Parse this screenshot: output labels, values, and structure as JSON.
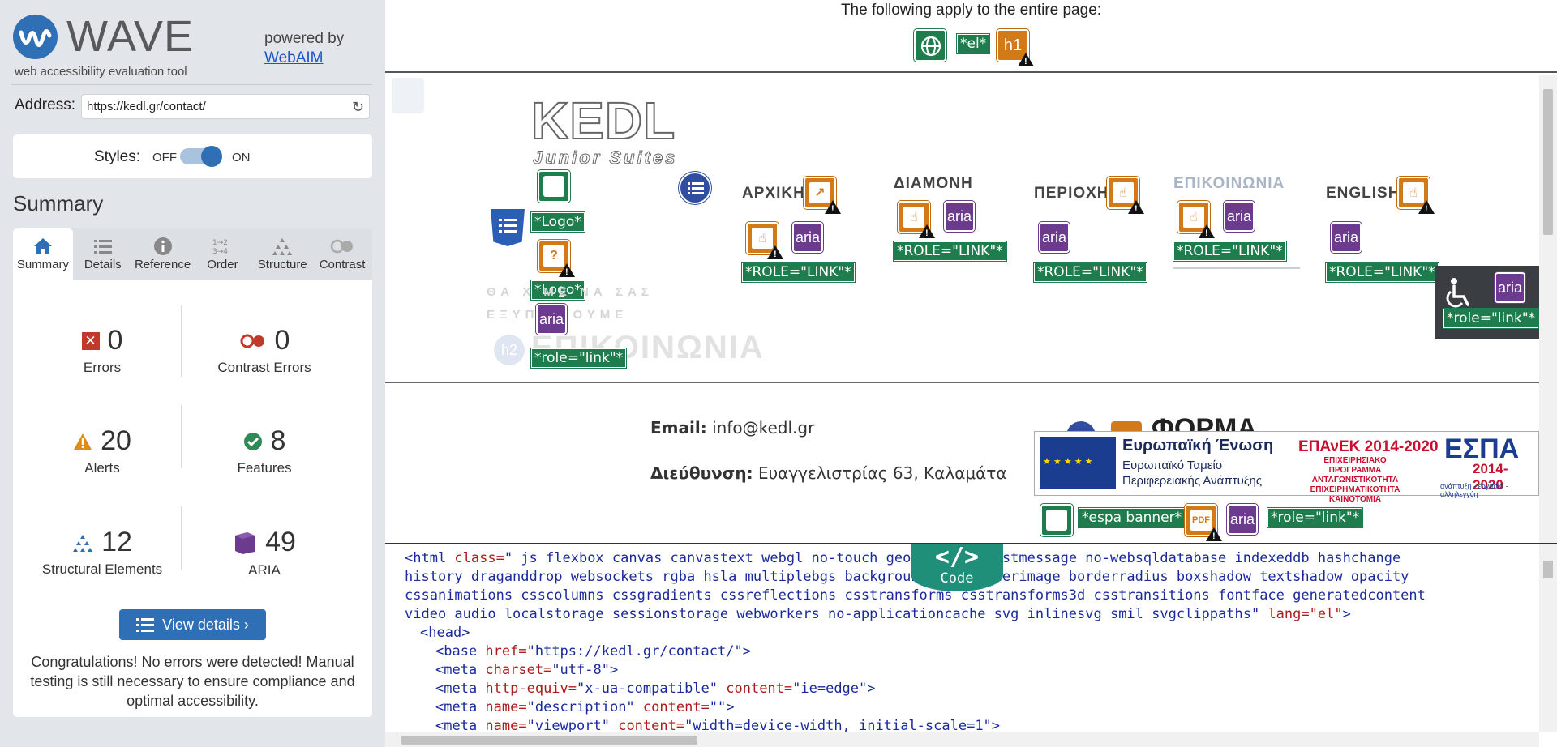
{
  "sidebar": {
    "brand": "WAVE",
    "tagline": "web accessibility evaluation tool",
    "powered_by": "powered by",
    "powered_link": "WebAIM",
    "address_label": "Address:",
    "address_value": "https://kedl.gr/contact/",
    "styles_label": "Styles:",
    "styles_off": "OFF",
    "styles_on": "ON",
    "styles_state": "on",
    "summary_title": "Summary",
    "tabs": [
      {
        "label": "Summary",
        "icon": "home-icon",
        "active": true
      },
      {
        "label": "Details",
        "icon": "list-icon",
        "active": false
      },
      {
        "label": "Reference",
        "icon": "info-icon",
        "active": false
      },
      {
        "label": "Order",
        "icon": "order-icon",
        "active": false
      },
      {
        "label": "Structure",
        "icon": "structure-icon",
        "active": false
      },
      {
        "label": "Contrast",
        "icon": "contrast-icon",
        "active": false
      }
    ],
    "stats": {
      "errors": {
        "value": "0",
        "label": "Errors"
      },
      "contrast": {
        "value": "0",
        "label": "Contrast Errors"
      },
      "alerts": {
        "value": "20",
        "label": "Alerts"
      },
      "features": {
        "value": "8",
        "label": "Features"
      },
      "structural": {
        "value": "12",
        "label": "Structural Elements"
      },
      "aria": {
        "value": "49",
        "label": "ARIA"
      }
    },
    "view_details": "View details ›",
    "congrats": "Congratulations! No errors were detected! Manual testing is still necessary to ensure compliance and optimal accessibility."
  },
  "topbar": {
    "apply_text": "The following apply to the entire page:",
    "lang_tag": "*el*",
    "h1_label": "h1"
  },
  "preview": {
    "brand_title": "KEDL",
    "brand_subtitle": "Junior Suites",
    "logo_tag_1": "*Logo*",
    "logo_tag_2": "*Logo*",
    "role_link_lower": "*role=\"link\"*",
    "faded_line_1": "ΘΑ Χ   ΜΕ ΝΑ ΣΑΣ",
    "faded_line_2": "ΕΞΥΠ   ΗΣΟΥΜΕ",
    "faded_heading": "ΕΠΙΚΟΙΝΩΝΙΑ",
    "h2_label": "h2",
    "aria_label": "aria",
    "nav": [
      {
        "label": "ΑΡΧΙΚΗ",
        "tag": "*ROLE=\"LINK\"*"
      },
      {
        "label": "ΔΙΑΜΟΝΗ",
        "tag": "*ROLE=\"LINK\"*"
      },
      {
        "label": "ΠΕΡΙΟΧΗ",
        "tag": "*ROLE=\"LINK\"*"
      },
      {
        "label": "ΕΠΙΚΟΙΝΩΝΙΑ",
        "tag": "*ROLE=\"LINK\"*"
      },
      {
        "label": "ENGLISH",
        "tag": "*ROLE=\"LINK\"*"
      }
    ],
    "access_tag": "*role=\"link\"*",
    "email_label": "Email:",
    "email_value": "info@kedl.gr",
    "address_label": "Διεύθυνση:",
    "address_value": "Ευαγγελιστρίας 63, Καλαμάτα",
    "form_heading": "ΦΟΡΜΑ",
    "espa": {
      "title": "Ευρωπαϊκή Ένωση",
      "sub1": "Ευρωπαϊκό Ταμείο",
      "sub2": "Περιφερειακής Ανάπτυξης",
      "program": "ΕΠΑνΕΚ 2014-2020",
      "program_sub1": "ΕΠΙΧΕΙΡΗΣΙΑΚΟ ΠΡΟΓΡΑΜΜΑ",
      "program_sub2": "ΑΝΤΑΓΩΝΙΣΤΙΚΟΤΗΤΑ",
      "program_sub3": "ΕΠΙΧΕΙΡΗΜΑΤΙΚΟΤΗΤΑ",
      "program_sub4": "ΚΑΙΝΟΤΟΜΙΑ",
      "espa_title": "ΕΣΠΑ",
      "espa_years": "2014-2020",
      "espa_motto": "ανάπτυξη - εργασία - αλληλεγγύη"
    },
    "espa_tag": "*espa banner*",
    "pdf_label": "PDF",
    "espa_role_tag": "*role=\"link\"*"
  },
  "code": {
    "tab_label": "Code",
    "tab_symbol": "</>",
    "line1_tag": "<html",
    "line1_attr": " class=",
    "line1_val": "\" js flexbox canvas canvastext webgl no-touch geolocation postmessage no-websqldatabase indexeddb hashchange",
    "line2": "history draganddrop websockets rgba hsla multiplebgs backgroundsize borderimage borderradius boxshadow textshadow opacity",
    "line3": "cssanimations csscolumns cssgradients cssreflections csstransforms csstransforms3d csstransitions fontface generatedcontent",
    "line4_val": "video audio localstorage sessionstorage webworkers no-applicationcache svg inlinesvg smil svgclippaths\"",
    "line4_attr": " lang=",
    "line4_lang": "\"el\"",
    "line4_end": ">",
    "head": "<head>",
    "base_tag": "<base",
    "base_attr": " href=",
    "base_val": "\"https://kedl.gr/contact/\"",
    "base_end": ">",
    "meta1_tag": "<meta",
    "meta1_attr": " charset=",
    "meta1_val": "\"utf-8\"",
    "meta1_end": ">",
    "meta2_tag": "<meta",
    "meta2_attr": " http-equiv=",
    "meta2_val": "\"x-ua-compatible\"",
    "meta2_attr2": " content=",
    "meta2_val2": "\"ie=edge\"",
    "meta2_end": ">",
    "meta3_tag": "<meta",
    "meta3_attr": " name=",
    "meta3_val": "\"description\"",
    "meta3_attr2": " content=",
    "meta3_val2": "\"\"",
    "meta3_end": ">",
    "meta4_tag": "<meta",
    "meta4_attr": " name=",
    "meta4_val": "\"viewport\"",
    "meta4_attr2": " content=",
    "meta4_val2": "\"width=device-width, initial-scale=1\"",
    "meta4_end": ">"
  },
  "colors": {
    "wave_blue": "#2f6fb6",
    "feature_green": "#1f7d4d",
    "alert_orange": "#d27a17",
    "aria_purple": "#6c3b8e",
    "error_red": "#c0392b"
  }
}
